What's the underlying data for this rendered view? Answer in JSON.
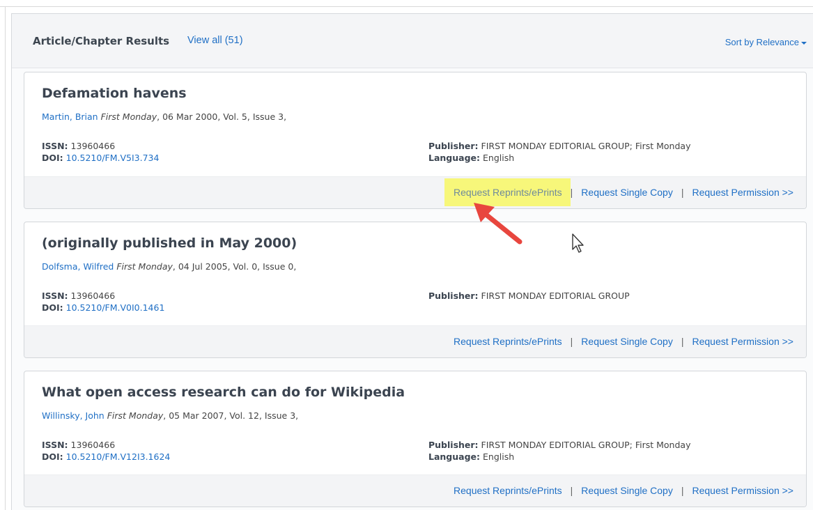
{
  "header": {
    "title": "Article/Chapter Results",
    "view_all": "View all (51)",
    "sort_label": "Sort by Relevance"
  },
  "labels": {
    "issn": "ISSN:",
    "doi": "DOI:",
    "publisher": "Publisher:",
    "language": "Language:"
  },
  "actions": {
    "reprints": "Request Reprints/ePrints",
    "single_copy": "Request Single Copy",
    "permission": "Request Permission >>",
    "separator": "|"
  },
  "results": [
    {
      "title": "Defamation havens",
      "author": "Martin, Brian",
      "journal": "First Monday",
      "details": ", 06 Mar 2000, Vol. 5, Issue 3,",
      "issn": "13960466",
      "doi": "10.5210/FM.V5I3.734",
      "publisher": "FIRST MONDAY EDITORIAL GROUP; First Monday",
      "language": "English"
    },
    {
      "title": "(originally published in May 2000)",
      "author": "Dolfsma, Wilfred",
      "journal": "First Monday",
      "details": ", 04 Jul 2005, Vol. 0, Issue 0,",
      "issn": "13960466",
      "doi": "10.5210/FM.V0I0.1461",
      "publisher": "FIRST MONDAY EDITORIAL GROUP",
      "language": ""
    },
    {
      "title": "What open access research can do for Wikipedia",
      "author": "Willinsky, John",
      "journal": "First Monday",
      "details": ", 05 Mar 2007, Vol. 12, Issue 3,",
      "issn": "13960466",
      "doi": "10.5210/FM.V12I3.1624",
      "publisher": "FIRST MONDAY EDITORIAL GROUP; First Monday",
      "language": "English"
    }
  ],
  "colors": {
    "link": "#1f6fc5",
    "highlight": "#f7f77a",
    "annotation_arrow": "#e8463e"
  },
  "icons": {
    "annotation": "red-arrow-icon",
    "pointer": "mouse-cursor-icon"
  }
}
